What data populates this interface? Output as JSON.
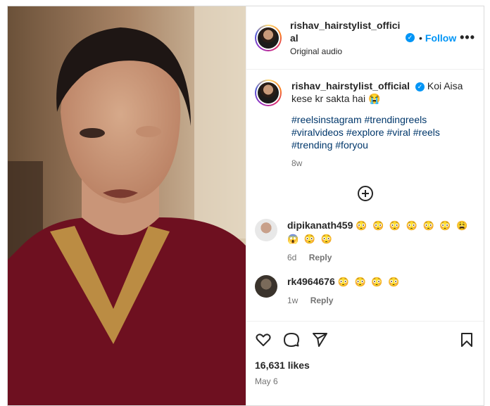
{
  "post": {
    "username": "rishav_hairstylist_official",
    "audio": "Original audio",
    "follow_label": "Follow",
    "more_label": "•••",
    "caption_text": "Koi Aisa kese kr sakta hai 😭",
    "hashtags": "#reelsinstagram #trendingreels #viralvideos #explore #viral #reels #trending #foryou",
    "time": "8w",
    "likes": "16,631 likes",
    "date": "May 6"
  },
  "comments": [
    {
      "user": "dipikanath459",
      "text": "😳 😳 😳 😳 😳 😳 😩 😱 😳 😳",
      "time": "6d",
      "reply": "Reply"
    },
    {
      "user": "rk4964676",
      "text": "😳 😳 😳 😳",
      "time": "1w",
      "reply": "Reply"
    }
  ],
  "colors": {
    "accent": "#0095f6",
    "hashtag": "#00376b"
  }
}
